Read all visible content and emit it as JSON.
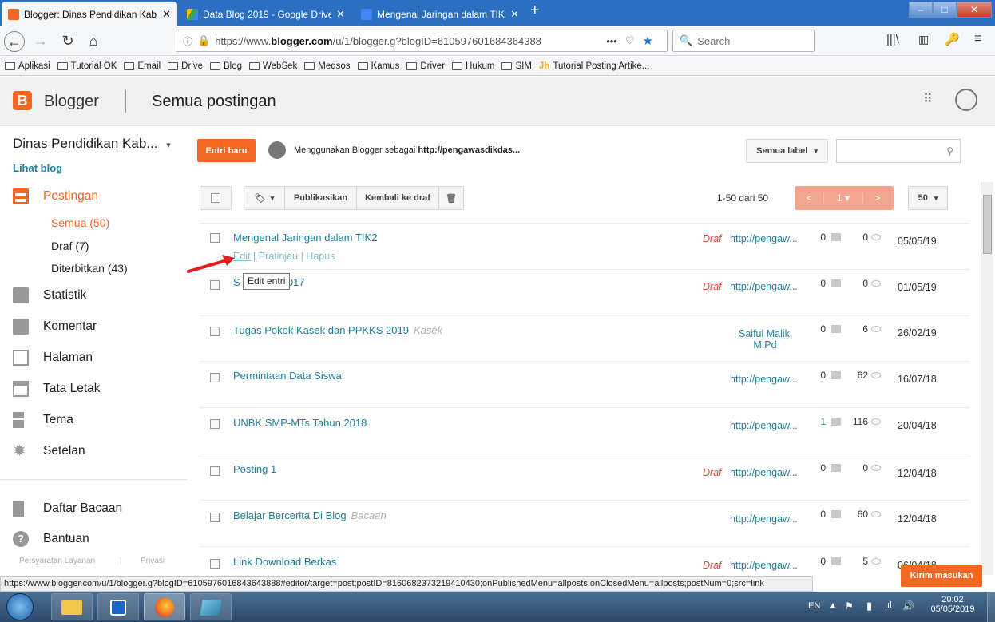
{
  "browser": {
    "tabs": [
      {
        "title": "Blogger: Dinas Pendidikan Kab.",
        "active": true
      },
      {
        "title": "Data Blog 2019 - Google Drive"
      },
      {
        "title": "Mengenal Jaringan dalam TIK2"
      }
    ],
    "url_prefix": "https://www.",
    "url_domain": "blogger.com",
    "url_rest": "/u/1/blogger.g?blogID=610597601684364388",
    "search_placeholder": "Search",
    "bookmarks": [
      "Aplikasi",
      "Tutorial OK",
      "Email",
      "Drive",
      "Blog",
      "WebSek",
      "Medsos",
      "Kamus",
      "Driver",
      "Hukum",
      "SIM",
      "Tutorial Posting Artike..."
    ]
  },
  "header": {
    "brand": "Blogger",
    "page_title": "Semua postingan"
  },
  "sidebar": {
    "blog_name": "Dinas Pendidikan Kab...",
    "view_blog": "Lihat blog",
    "posts_label": "Postingan",
    "sub": {
      "all": "Semua (50)",
      "draft": "Draf (7)",
      "published": "Diterbitkan (43)"
    },
    "items": [
      "Statistik",
      "Komentar",
      "Halaman",
      "Tata Letak",
      "Tema",
      "Setelan"
    ],
    "reading_list": "Daftar Bacaan",
    "help": "Bantuan",
    "terms": "Persyaratan Layanan",
    "privacy": "Privasi"
  },
  "toolbar": {
    "new_post": "Entri baru",
    "using_prefix": "Menggunakan Blogger sebagai ",
    "using_bold": "http://pengawasdikdas...",
    "all_labels": "Semua label",
    "publish": "Publikasikan",
    "revert": "Kembali ke draf",
    "range": "1-50 dari 50",
    "page": "1",
    "per_page": "50"
  },
  "row_actions": {
    "edit": "Edit",
    "preview": "Pratinjau",
    "delete": "Hapus",
    "sep": " | "
  },
  "tooltip": "Edit entri",
  "posts": [
    {
      "title": "Mengenal Jaringan dalam TIK2",
      "label": "",
      "status": "Draf",
      "author": "http://pengaw...",
      "comments": "0",
      "views": "0",
      "date": "05/05/19"
    },
    {
      "title": "S",
      "title_tail": "2017",
      "label": "",
      "status": "Draf",
      "author": "http://pengaw...",
      "comments": "0",
      "views": "0",
      "date": "01/05/19"
    },
    {
      "title": "Tugas Pokok Kasek dan PPKKS 2019",
      "label": "Kasek",
      "status": "",
      "author": "Saiful Malik,",
      "author2": "M.Pd",
      "comments": "0",
      "views": "6",
      "date": "26/02/19"
    },
    {
      "title": "Permintaan Data Siswa",
      "label": "",
      "status": "",
      "author": "http://pengaw...",
      "comments": "0",
      "views": "62",
      "date": "16/07/18"
    },
    {
      "title": "UNBK SMP-MTs Tahun 2018",
      "label": "",
      "status": "",
      "author": "http://pengaw...",
      "comments": "1",
      "views": "116",
      "date": "20/04/18"
    },
    {
      "title": "Posting 1",
      "label": "",
      "status": "Draf",
      "author": "http://pengaw...",
      "comments": "0",
      "views": "0",
      "date": "12/04/18"
    },
    {
      "title": "Belajar Bercerita Di Blog",
      "label": "Bacaan",
      "status": "",
      "author": "http://pengaw...",
      "comments": "0",
      "views": "60",
      "date": "12/04/18"
    },
    {
      "title": "Link Download Berkas",
      "label": "",
      "status": "Draf",
      "author": "http://pengaw...",
      "comments": "0",
      "views": "5",
      "date": "06/04/18"
    }
  ],
  "feedback": "Kirim masukan",
  "status_url": "https://www.blogger.com/u/1/blogger.g?blogID=6105976016843643888#editor/target=post;postID=8160682373219410430;onPublishedMenu=allposts;onClosedMenu=allposts;postNum=0;src=link",
  "taskbar": {
    "lang": "EN",
    "time": "20:02",
    "date": "05/05/2019"
  },
  "colors": {
    "accent": "#f26722",
    "link": "#1e7f9c",
    "draft": "#dd4b39",
    "pager": "#f4a58f"
  }
}
